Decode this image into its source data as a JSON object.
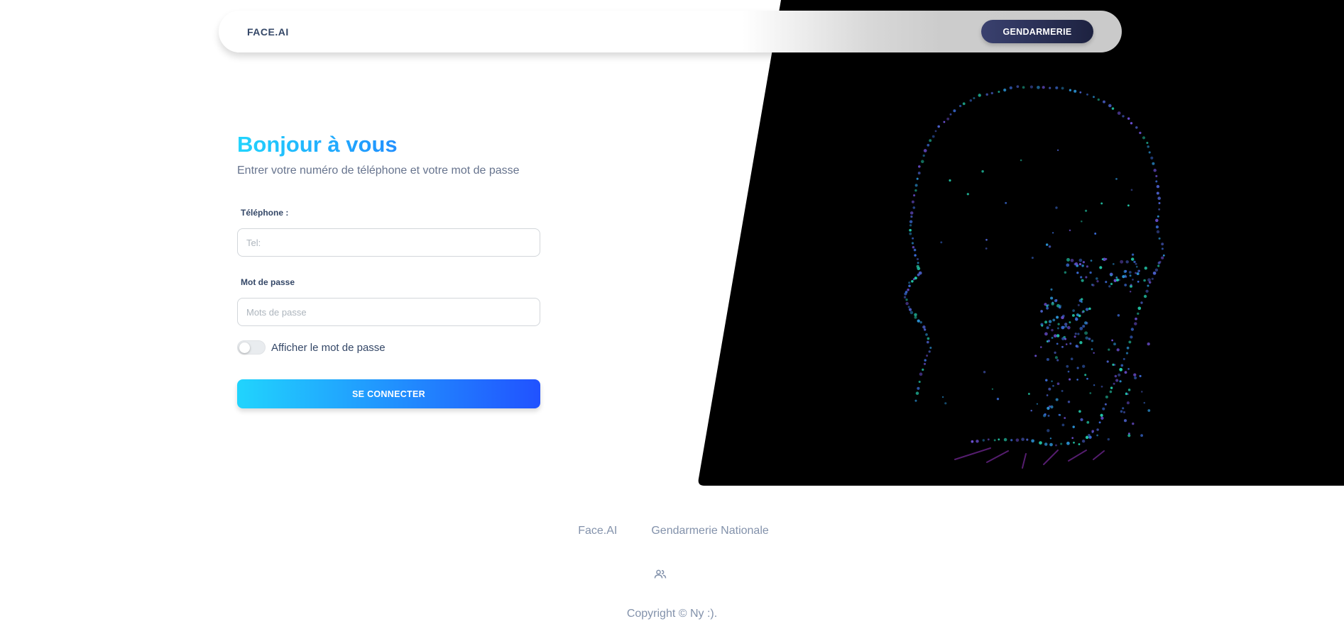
{
  "navbar": {
    "brand": "FACE.AI",
    "button_label": "GENDARMERIE"
  },
  "login": {
    "title": "Bonjour à vous",
    "subtitle": "Entrer votre numéro de téléphone et votre mot de passe",
    "phone_label": "Téléphone :",
    "phone_placeholder": "Tel:",
    "phone_value": "",
    "password_label": "Mot de passe",
    "password_placeholder": "Mots de passe",
    "password_value": "",
    "show_password_label": "Afficher le mot de passe",
    "show_password_on": false,
    "submit_label": "SE CONNECTER"
  },
  "footer": {
    "links": [
      "Face.AI",
      "Gendarmerie Nationale"
    ],
    "icon": "users-icon",
    "copyright": "Copyright © Ny :)."
  },
  "colors": {
    "gradient_start": "#21d4fd",
    "gradient_end": "#2152ff",
    "dark_button": "#3a416f",
    "text_dark": "#344767",
    "text_muted": "#67748e",
    "footer_text": "#8392ab"
  },
  "illustration": {
    "icon": "face-mesh-illustration"
  }
}
